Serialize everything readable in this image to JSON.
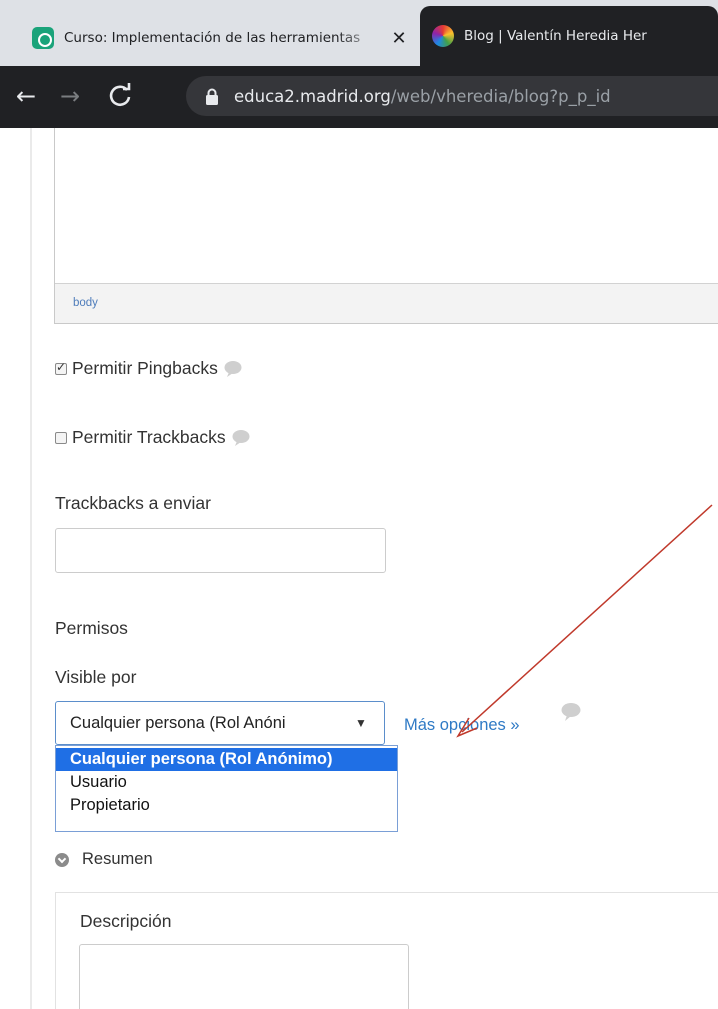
{
  "browser": {
    "tabs": [
      {
        "title": "Curso: Implementación de las herramientas",
        "close": "✕"
      },
      {
        "title": "Blog | Valentín Heredia Her"
      }
    ],
    "nav": {
      "back": "←",
      "forward": "→",
      "reload": "C"
    },
    "url": {
      "host": "educa2.madrid.org",
      "path": "/web/vheredia/blog?p_p_id"
    }
  },
  "editor": {
    "path_label": "body"
  },
  "form": {
    "pingbacks": {
      "label": "Permitir Pingbacks",
      "checked": true
    },
    "trackbacks": {
      "label": "Permitir Trackbacks",
      "checked": false
    },
    "trackbacks_to_send": {
      "label": "Trackbacks a enviar",
      "value": ""
    },
    "permissions_heading": "Permisos",
    "visible_by": {
      "label": "Visible por",
      "selected": "Cualquier persona (Rol Anóni",
      "caret": "▼",
      "options": [
        "Cualquier persona (Rol Anónimo)",
        "Usuario",
        "Propietario"
      ]
    },
    "more_options": "Más opciones »",
    "summary": {
      "toggle_label": "Resumen",
      "description_label": "Descripción"
    }
  },
  "colors": {
    "annotation_arrow": "#c0392b",
    "link": "#2f7ac5",
    "option_highlight": "#1f6fe5"
  }
}
